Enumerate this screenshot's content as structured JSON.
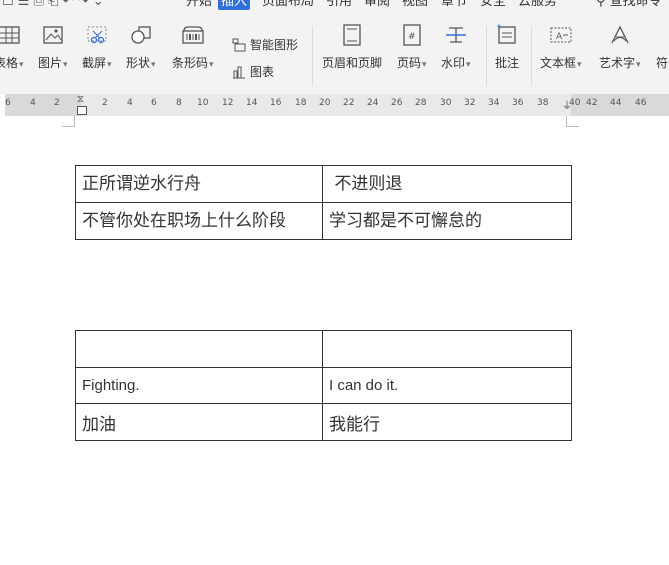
{
  "menubar": {
    "items": [
      "开始",
      "插入",
      "页面布局",
      "引用",
      "审阅",
      "视图",
      "章节",
      "安全",
      "云服务"
    ],
    "active": "插入",
    "search_label": "查找命令"
  },
  "ribbon": {
    "table_label": "表格",
    "picture_label": "图片",
    "screenshot_label": "截屏",
    "shape_label": "形状",
    "barcode_label": "条形码",
    "smartart_label": "智能图形",
    "chart_label": "图表",
    "header_footer_label": "页眉和页脚",
    "page_number_label": "页码",
    "watermark_label": "水印",
    "comment_label": "批注",
    "textbox_label": "文本框",
    "wordart_label": "艺术字",
    "symbol_label": "符"
  },
  "ruler": {
    "ticks": [
      "6",
      "4",
      "2",
      "2",
      "4",
      "6",
      "8",
      "10",
      "12",
      "14",
      "16",
      "18",
      "20",
      "22",
      "24",
      "26",
      "28",
      "30",
      "32",
      "34",
      "36",
      "38",
      "40",
      "42",
      "44",
      "46"
    ]
  },
  "document": {
    "table1": {
      "rows": [
        [
          "正所谓逆水行舟",
          " 不进则退"
        ],
        [
          "不管你处在职场上什么阶段",
          "学习都是不可懈怠的"
        ]
      ]
    },
    "table2": {
      "rows": [
        [
          "",
          ""
        ],
        [
          "Fighting.",
          "I can do it."
        ],
        [
          "加油",
          "我能行"
        ]
      ]
    }
  }
}
